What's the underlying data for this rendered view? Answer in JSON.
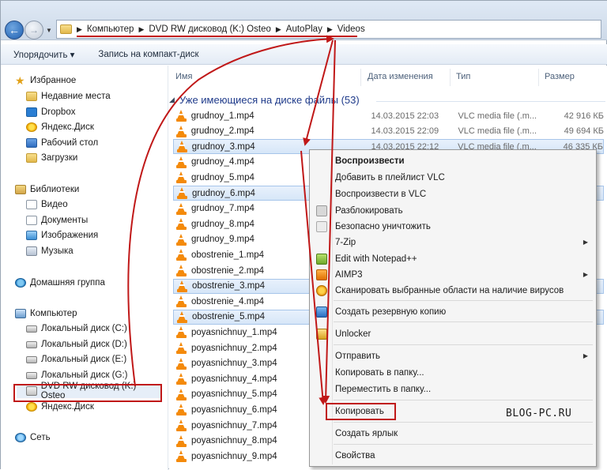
{
  "breadcrumb": [
    "Компьютер",
    "DVD RW дисковод (K:) Osteo",
    "AutoPlay",
    "Videos"
  ],
  "toolbar": {
    "organize": "Упорядочить ▾",
    "burn": "Запись на компакт-диск"
  },
  "sidebar": {
    "favorites": "Избранное",
    "recent": "Недавние места",
    "dropbox": "Dropbox",
    "yadisk": "Яндекс.Диск",
    "desktop": "Рабочий стол",
    "downloads": "Загрузки",
    "libraries": "Библиотеки",
    "video": "Видео",
    "documents": "Документы",
    "images": "Изображения",
    "music": "Музыка",
    "homegroup": "Домашняя группа",
    "computer": "Компьютер",
    "disk_c": "Локальный диск (C:)",
    "disk_d": "Локальный диск (D:)",
    "disk_e": "Локальный диск (E:)",
    "disk_g": "Локальный диск (G:)",
    "dvd": "DVD RW дисковод (K:) Osteo",
    "yadisk2": "Яндекс.Диск",
    "network": "Сеть"
  },
  "columns": {
    "name": "Имя",
    "date": "Дата изменения",
    "type": "Тип",
    "size": "Размер"
  },
  "group_label": "Уже имеющиеся на диске файлы (53)",
  "files": [
    {
      "name": "grudnoy_1.mp4",
      "date": "14.03.2015 22:03",
      "type": "VLC media file (.m...",
      "size": "42 916 КБ",
      "selected": false
    },
    {
      "name": "grudnoy_2.mp4",
      "date": "14.03.2015 22:09",
      "type": "VLC media file (.m...",
      "size": "49 694 КБ",
      "selected": false
    },
    {
      "name": "grudnoy_3.mp4",
      "date": "14.03.2015 22:12",
      "type": "VLC media file (.m...",
      "size": "46 335 КБ",
      "selected": true
    },
    {
      "name": "grudnoy_4.mp4",
      "selected": false
    },
    {
      "name": "grudnoy_5.mp4",
      "selected": false
    },
    {
      "name": "grudnoy_6.mp4",
      "selected": true
    },
    {
      "name": "grudnoy_7.mp4",
      "selected": false
    },
    {
      "name": "grudnoy_8.mp4",
      "selected": false
    },
    {
      "name": "grudnoy_9.mp4",
      "selected": false
    },
    {
      "name": "obostrenie_1.mp4",
      "selected": false
    },
    {
      "name": "obostrenie_2.mp4",
      "selected": false
    },
    {
      "name": "obostrenie_3.mp4",
      "selected": true
    },
    {
      "name": "obostrenie_4.mp4",
      "selected": false
    },
    {
      "name": "obostrenie_5.mp4",
      "selected": true
    },
    {
      "name": "poyasnichnuy_1.mp4",
      "selected": false
    },
    {
      "name": "poyasnichnuy_2.mp4",
      "selected": false
    },
    {
      "name": "poyasnichnuy_3.mp4",
      "selected": false
    },
    {
      "name": "poyasnichnuy_4.mp4",
      "selected": false
    },
    {
      "name": "poyasnichnuy_5.mp4",
      "selected": false
    },
    {
      "name": "poyasnichnuy_6.mp4",
      "selected": false
    },
    {
      "name": "poyasnichnuy_7.mp4",
      "selected": false
    },
    {
      "name": "poyasnichnuy_8.mp4",
      "selected": false
    },
    {
      "name": "poyasnichnuy_9.mp4",
      "selected": false
    }
  ],
  "context_menu": {
    "play": "Воспроизвести",
    "add_playlist": "Добавить в плейлист VLC",
    "play_vlc": "Воспроизвести в VLC",
    "unblock": "Разблокировать",
    "secure_delete": "Безопасно уничтожить",
    "sevenzip": "7-Zip",
    "notepad": "Edit with Notepad++",
    "aimp": "AIMP3",
    "scan": "Сканировать выбранные области на наличие вирусов",
    "backup": "Создать резервную копию",
    "unlocker": "Unlocker",
    "send_to": "Отправить",
    "copy_to": "Копировать в папку...",
    "move_to": "Переместить в папку...",
    "copy": "Копировать",
    "shortcut": "Создать ярлык",
    "properties": "Свойства"
  },
  "watermark": "BLOG-PC.RU",
  "annotation_color": "#c01818"
}
